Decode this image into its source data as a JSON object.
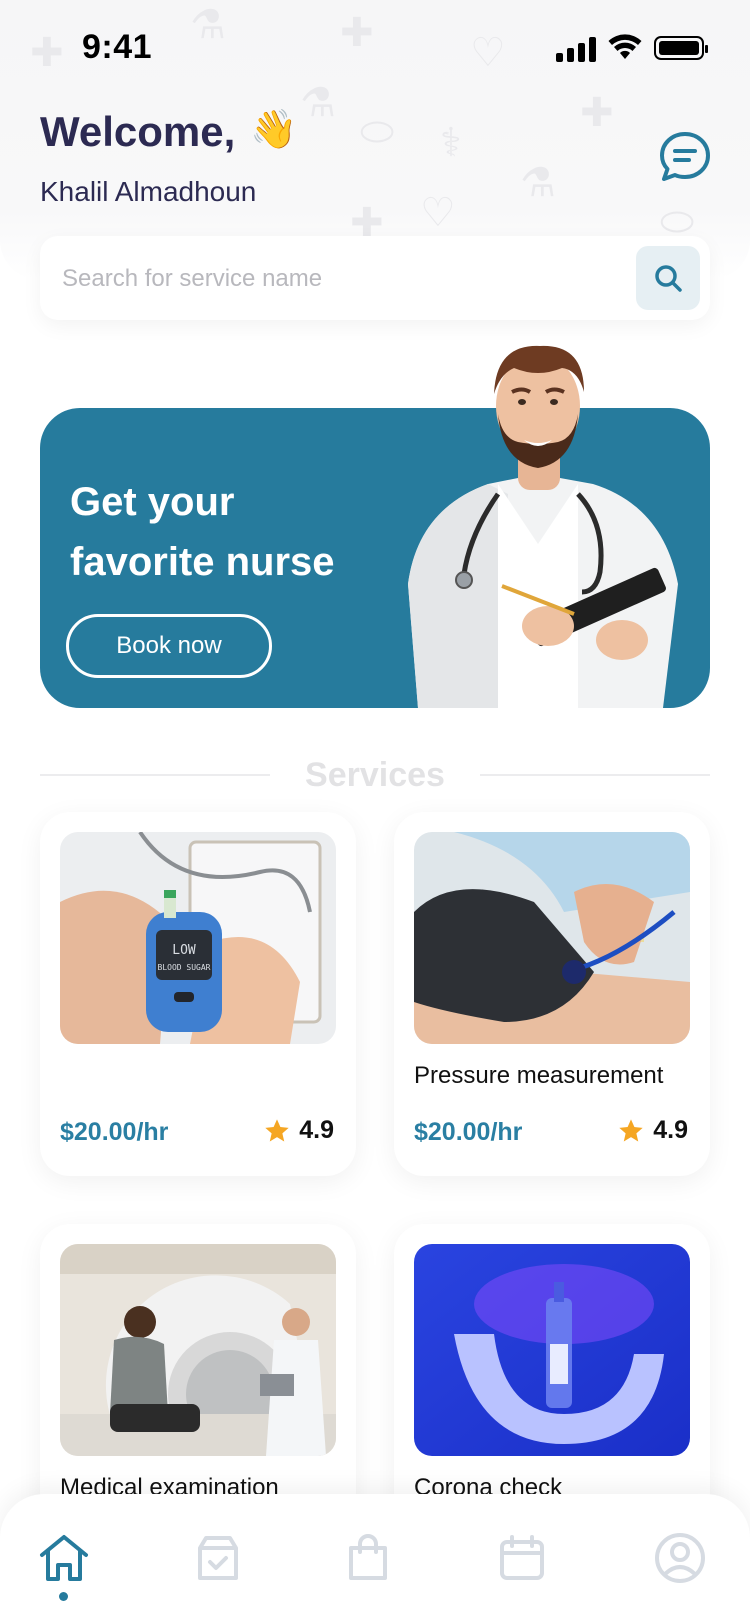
{
  "status": {
    "time": "9:41"
  },
  "header": {
    "welcome": "Welcome,",
    "wave_emoji": "👋",
    "username": "Khalil Almadhoun",
    "chat_icon": "chat-icon"
  },
  "search": {
    "placeholder": "Search for service name",
    "value": "",
    "icon": "search-icon"
  },
  "banner": {
    "title_line1": "Get your",
    "title_line2": "favorite nurse",
    "button": "Book now"
  },
  "services": {
    "title": "Services",
    "items": [
      {
        "name": "",
        "price": "$20.00/hr",
        "rating": "4.9"
      },
      {
        "name": "Pressure measurement",
        "price": "$20.00/hr",
        "rating": "4.9"
      },
      {
        "name": "Medical examination",
        "price": "",
        "rating": ""
      },
      {
        "name": "Corona check",
        "price": "",
        "rating": ""
      }
    ]
  },
  "tabbar": {
    "items": [
      "home-icon",
      "orders-icon",
      "bag-icon",
      "calendar-icon",
      "profile-icon"
    ],
    "active": "home-icon"
  },
  "colors": {
    "primary": "#267b9d",
    "text_dark": "#2c2a52",
    "star": "#f5a623"
  }
}
